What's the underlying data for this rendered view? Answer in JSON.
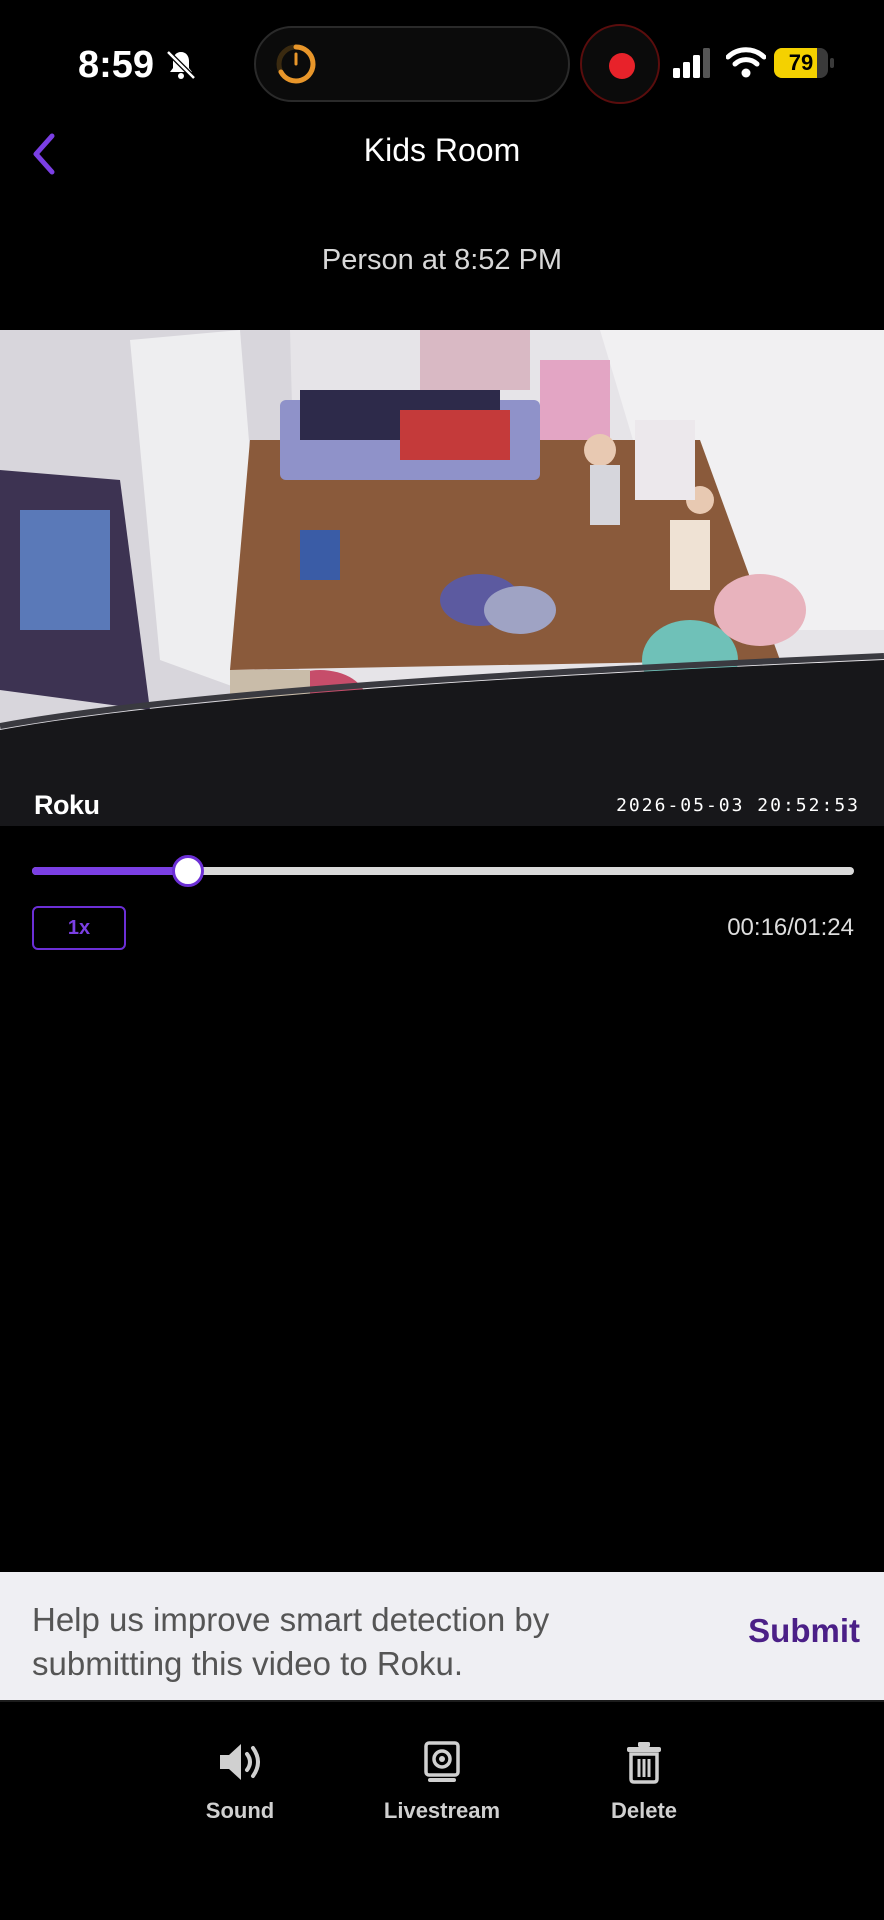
{
  "status_bar": {
    "time": "8:59",
    "battery_level": "79",
    "icons": [
      "bell-slash-icon",
      "activity-ring-icon",
      "recording-icon",
      "signal-icon",
      "wifi-icon",
      "battery-icon"
    ],
    "colors": {
      "battery": "#f4d100",
      "record": "#e8222a"
    }
  },
  "header": {
    "title": "Kids Room",
    "event": "Person at 8:52 PM",
    "back_icon": "chevron-left-icon"
  },
  "video": {
    "brand": "Roku",
    "timestamp": "2026-05-03  20:52:53"
  },
  "player": {
    "progress": 0.19,
    "speed": "1x",
    "elapsed_total": "00:16/01:24",
    "accent": "#7b3fe4"
  },
  "feedback": {
    "message": "Help us improve smart detection by submitting this video to Roku.",
    "submit": "Submit",
    "submit_color": "#4b1f87"
  },
  "actions": [
    {
      "label": "Sound",
      "icon": "speaker-icon"
    },
    {
      "label": "Livestream",
      "icon": "livestream-icon"
    },
    {
      "label": "Delete",
      "icon": "trash-icon"
    }
  ]
}
